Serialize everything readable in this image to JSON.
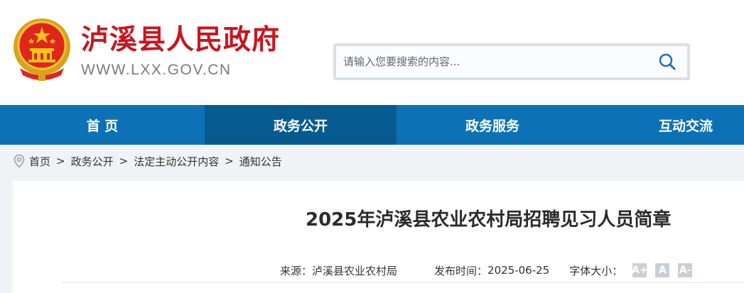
{
  "header": {
    "site_title": "泸溪县人民政府",
    "site_domain": "WWW.LXX.GOV.CN",
    "emblem_icon": "national-emblem-icon",
    "search": {
      "placeholder": "请输入您要搜索的内容...",
      "value": "",
      "icon": "search-icon"
    }
  },
  "nav": {
    "items": [
      {
        "label": "首 页",
        "active": false
      },
      {
        "label": "政务公开",
        "active": true
      },
      {
        "label": "政务服务",
        "active": false
      },
      {
        "label": "互动交流",
        "active": false
      }
    ]
  },
  "breadcrumb": {
    "icon": "location-pin-icon",
    "items": [
      "首页",
      "政务公开",
      "法定主动公开内容",
      "通知公告"
    ],
    "separator": ">"
  },
  "article": {
    "title": "2025年泸溪县农业农村局招聘见习人员简章",
    "source_label": "来源：",
    "source": "泸溪县农业农村局",
    "date_label": "发布时间：",
    "date": "2025-06-25",
    "font_size_label": "字体大小：",
    "font_buttons": [
      "A+",
      "A",
      "A-"
    ]
  },
  "colors": {
    "brand_red": "#c8161e",
    "nav_blue": "#0c72b5",
    "nav_active": "#075b91",
    "page_bg": "#f0f2f5"
  }
}
